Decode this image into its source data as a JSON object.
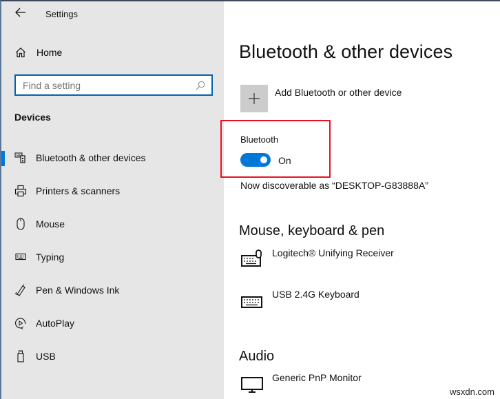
{
  "window": {
    "app_title": "Settings"
  },
  "sidebar": {
    "back_icon": "arrow-left-icon",
    "home": {
      "label": "Home",
      "icon": "home-icon"
    },
    "search": {
      "placeholder": "Find a setting",
      "value": "",
      "icon": "search-icon"
    },
    "section": "Devices",
    "items": [
      {
        "label": "Bluetooth & other devices",
        "icon": "bluetooth-devices-icon",
        "selected": true
      },
      {
        "label": "Printers & scanners",
        "icon": "printer-icon",
        "selected": false
      },
      {
        "label": "Mouse",
        "icon": "mouse-icon",
        "selected": false
      },
      {
        "label": "Typing",
        "icon": "keyboard-icon",
        "selected": false
      },
      {
        "label": "Pen & Windows Ink",
        "icon": "pen-icon",
        "selected": false
      },
      {
        "label": "AutoPlay",
        "icon": "autoplay-icon",
        "selected": false
      },
      {
        "label": "USB",
        "icon": "usb-icon",
        "selected": false
      }
    ]
  },
  "main": {
    "title": "Bluetooth & other devices",
    "add_device": {
      "label": "Add Bluetooth or other device",
      "icon": "plus-icon"
    },
    "bluetooth": {
      "label": "Bluetooth",
      "toggle_on": true,
      "state_label": "On",
      "discoverable_text": "Now discoverable as “DESKTOP-G83888A”"
    },
    "groups": [
      {
        "title": "Mouse, keyboard & pen",
        "devices": [
          {
            "name": "Logitech® Unifying Receiver",
            "icon": "keyboard-mouse-icon"
          },
          {
            "name": "USB 2.4G Keyboard",
            "icon": "keyboard-icon"
          }
        ]
      },
      {
        "title": "Audio",
        "devices": [
          {
            "name": "Generic PnP Monitor",
            "icon": "monitor-icon"
          }
        ]
      }
    ]
  },
  "colors": {
    "accent": "#0078d7",
    "highlight_border": "#e81123",
    "sidebar_bg": "#e6e6e6"
  },
  "watermark": "wsxdn.com"
}
